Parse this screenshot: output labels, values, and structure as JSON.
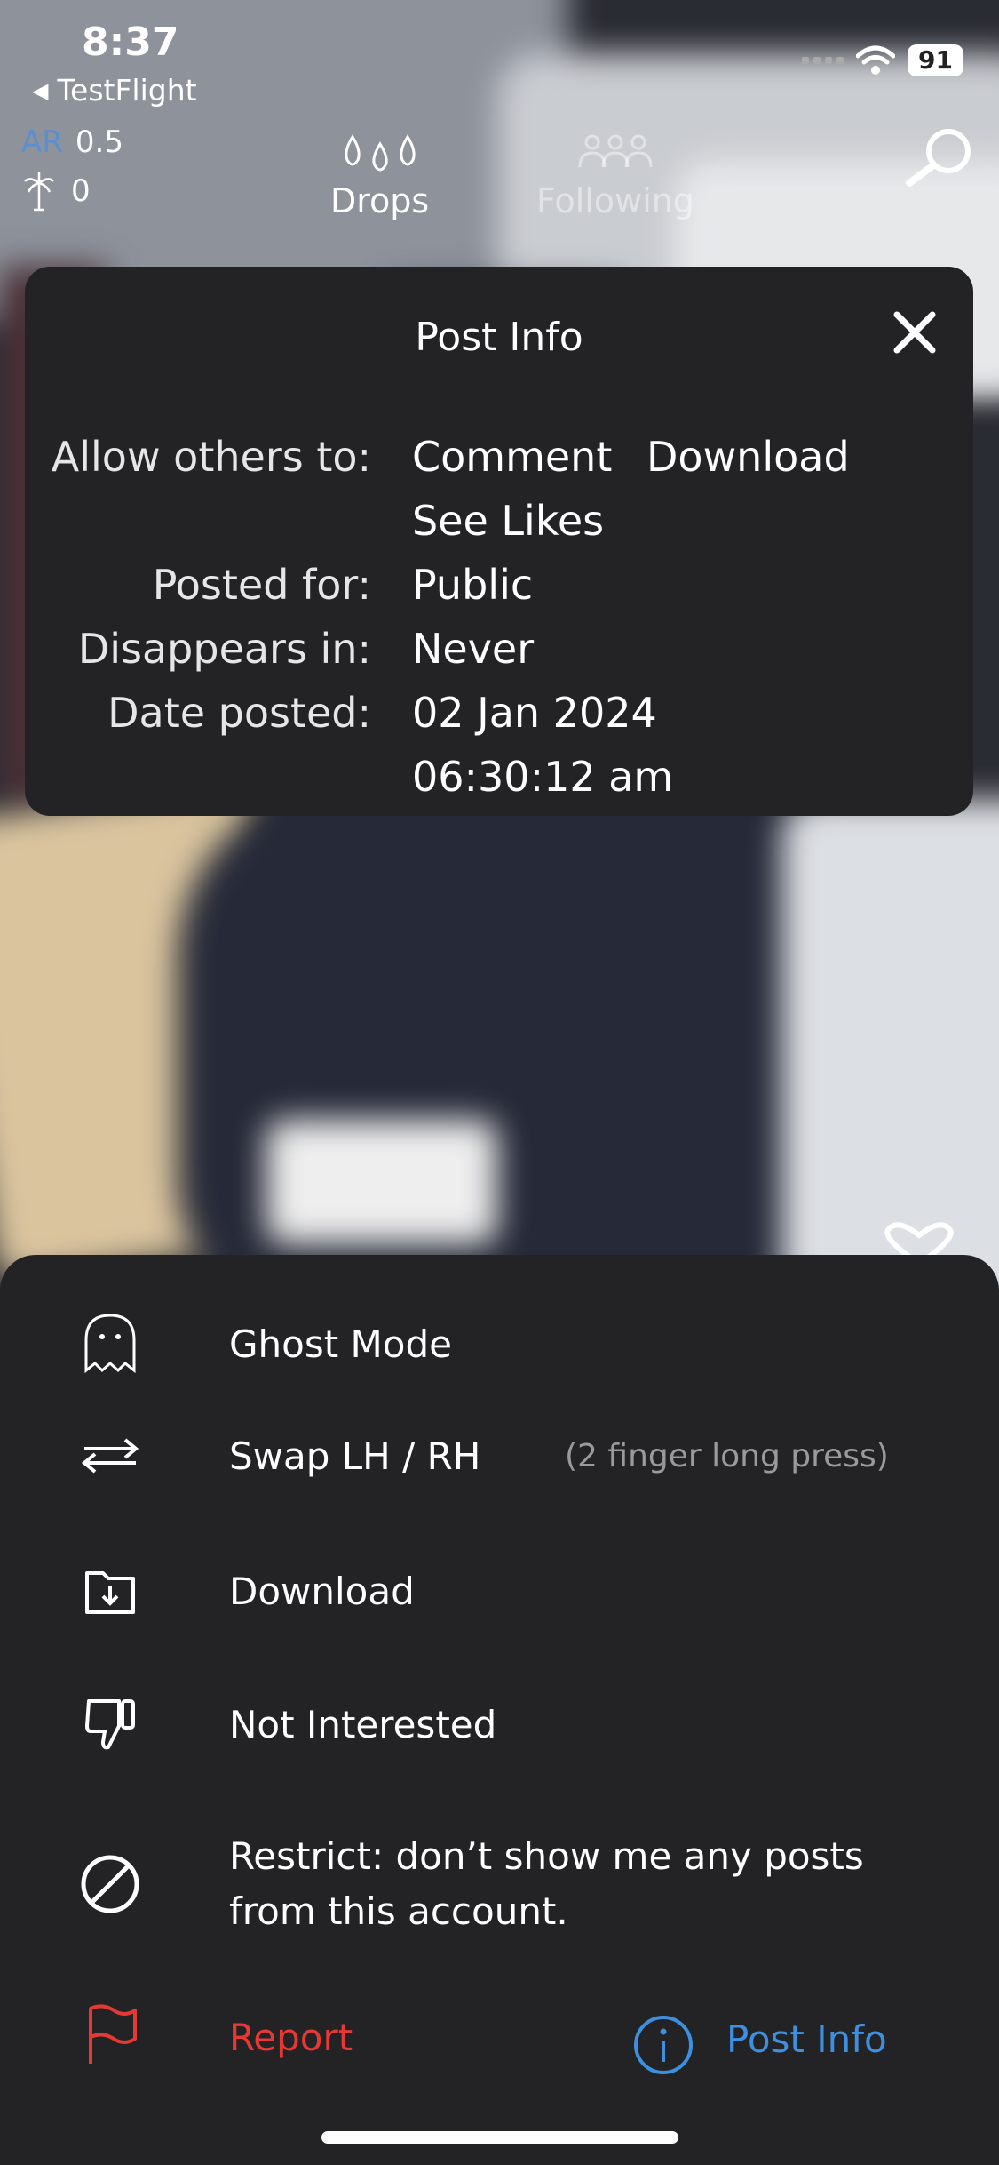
{
  "status_bar": {
    "time": "8:37",
    "back_app": "TestFlight",
    "battery": "91"
  },
  "stats": {
    "ar_label": "AR",
    "ar_value": "0.5",
    "coins": "0"
  },
  "tabs": {
    "drops": "Drops",
    "following": "Following"
  },
  "post_info": {
    "title": "Post Info",
    "allow_label": "Allow others to:",
    "allow_values": [
      "Comment",
      "Download"
    ],
    "allow_values_2": "See Likes",
    "posted_for_label": "Posted for:",
    "posted_for_value": "Public",
    "disappears_label": "Disappears in:",
    "disappears_value": "Never",
    "date_label": "Date posted:",
    "date_value": "02 Jan 2024",
    "time_value": "06:30:12 am"
  },
  "menu": {
    "ghost": "Ghost Mode",
    "swap": "Swap LH / RH",
    "swap_hint": "(2 finger long press)",
    "download": "Download",
    "not_interested": "Not Interested",
    "restrict_line1": "Restrict: don’t show me any posts",
    "restrict_line2": "from this account.",
    "report": "Report",
    "post_info": "Post Info"
  },
  "colors": {
    "report": "#e53935",
    "link": "#3d8fe0",
    "ar_label": "#5b8fd0",
    "sheet": "#232325"
  }
}
